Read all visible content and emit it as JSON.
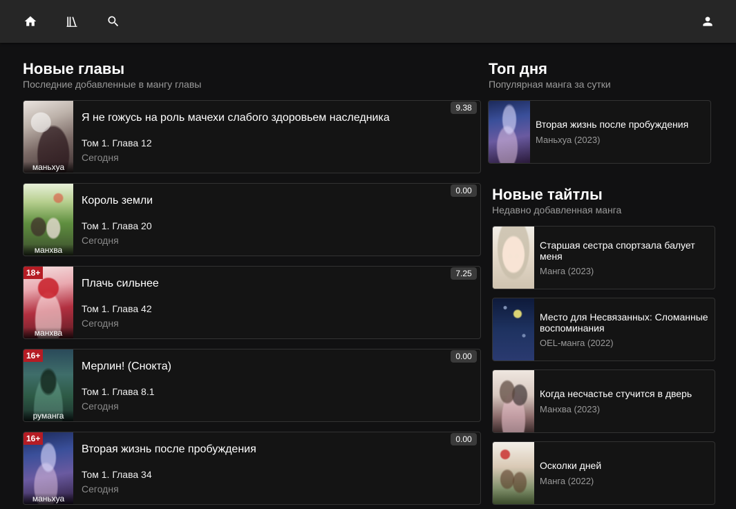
{
  "nav": {
    "icons": [
      "home-icon",
      "library-icon",
      "search-icon",
      "account-icon"
    ]
  },
  "new_chapters": {
    "title": "Новые главы",
    "subtitle": "Последние добавленные в мангу главы",
    "items": [
      {
        "title": "Я не гожусь на роль мачехи слабого здоровьем наследника",
        "chapter": "Том 1. Глава 12",
        "date": "Сегодня",
        "rating": "9.38",
        "type": "маньхуа",
        "age": ""
      },
      {
        "title": "Король земли",
        "chapter": "Том 1. Глава 20",
        "date": "Сегодня",
        "rating": "0.00",
        "type": "манхва",
        "age": ""
      },
      {
        "title": "Плачь сильнее",
        "chapter": "Том 1. Глава 42",
        "date": "Сегодня",
        "rating": "7.25",
        "type": "манхва",
        "age": "18+"
      },
      {
        "title": "Мерлин! (Снокта)",
        "chapter": "Том 1. Глава 8.1",
        "date": "Сегодня",
        "rating": "0.00",
        "type": "руманга",
        "age": "16+"
      },
      {
        "title": "Вторая жизнь после пробуждения",
        "chapter": "Том 1. Глава 34",
        "date": "Сегодня",
        "rating": "0.00",
        "type": "маньхуа",
        "age": "16+"
      }
    ]
  },
  "top_day": {
    "title": "Топ дня",
    "subtitle": "Популярная манга за сутки",
    "items": [
      {
        "title": "Вторая жизнь после пробуждения",
        "meta": "Маньхуа (2023)"
      }
    ]
  },
  "new_titles": {
    "title": "Новые тайтлы",
    "subtitle": "Недавно добавленная манга",
    "items": [
      {
        "title": "Старшая сестра спортзала балует меня",
        "meta": "Манга (2023)"
      },
      {
        "title": "Место для Несвязанных: Сломанные воспоминания",
        "meta": "OEL-манга (2022)"
      },
      {
        "title": "Когда несчастье стучится в дверь",
        "meta": "Манхва (2023)"
      },
      {
        "title": "Осколки дней",
        "meta": "Манга (2022)"
      }
    ]
  },
  "colors": {
    "background": "#111112",
    "topbar": "#262626",
    "age_badge": "#b51c24",
    "rating_bg": "#3a3a3a"
  }
}
